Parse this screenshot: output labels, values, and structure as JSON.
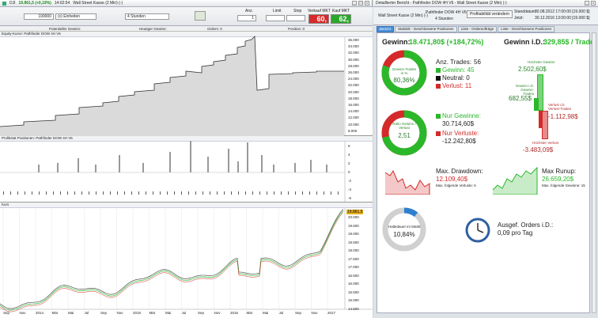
{
  "left_window": {
    "title_prefix": "DJI",
    "title_change": "19.861,5 (+0,19%)",
    "title_time": "14:02:54",
    "title_rest": "Wall Street Kasse (2 Min) (-)",
    "toolbar": {
      "qty_value": "100000",
      "unit_select": "(x) Einheiten",
      "period_select": "4 Stunden",
      "anz_label": "Anz.",
      "anz_value": "1",
      "limit_label": "Limit",
      "stop_label": "Stop",
      "sell_label": "Verkauf MKT",
      "sell_price": "60,",
      "buy_label": "Kauf MKT",
      "buy_price": "62,"
    },
    "header": {
      "potential": "Potentieller Gewinn:",
      "today": "Heutiger Gewinn:",
      "orders": "Orders: 0",
      "position": "Position: 0"
    },
    "equity": {
      "title": "Equity-Kurve: Pathfinder DOW 4H V6",
      "ticks": [
        "36.000",
        "34.000",
        "32.000",
        "30.000",
        "28.000",
        "26.000",
        "24.000",
        "22.000",
        "20.000",
        "18.000",
        "16.000",
        "14.000",
        "12.000",
        "10.000",
        "8.000"
      ],
      "last": "26.000"
    },
    "positions": {
      "title": "Prolikstat Positionen: Pathfinder DOW 4H V6",
      "ticks": [
        "6",
        "4",
        "2",
        "0",
        "-2",
        "-4",
        "-6"
      ]
    },
    "price": {
      "title": "Kurs",
      "last_label": "19.861,5",
      "ticks": [
        "20.000",
        "19.500",
        "19.000",
        "18.500",
        "18.000",
        "17.500",
        "17.000",
        "16.500",
        "16.000",
        "15.500",
        "15.000",
        "14.500"
      ]
    },
    "xaxis": [
      "Sep",
      "Nov",
      "2014",
      "Mär",
      "Mai",
      "Jul",
      "Sep",
      "Nov",
      "2015",
      "Mär",
      "Mai",
      "Jul",
      "Sep",
      "Nov",
      "2016",
      "Mär",
      "Mai",
      "Jul",
      "Sep",
      "Nov",
      "2017"
    ]
  },
  "right_window": {
    "title": "Detaillierter Bericht - Pathfinder DOW 4H V6 - Wall Street Kasse (2 Min) (-)",
    "header": {
      "instrument": "Wall Street Kasse (2 Min) (-)",
      "strategy": "Pathfinder DOW 4H V6",
      "period": "4 Stunden",
      "button": "Profitabilität verändern",
      "start_label": "Standdatum:",
      "start_value": "30.08.2012 17:00:00 [19.000 $]",
      "end_label": "Jetzt:",
      "end_value": "30.12.2016 13:00:00 [19.000 $]"
    },
    "tabs": [
      "Bericht",
      "Statistik - Geschlossene Positionen",
      "Liste - Ordereufträge",
      "Liste - Geschlossene Positionen"
    ],
    "gain": {
      "label": "Gewinn:",
      "value": "18.471,80$ (+184,72%)"
    },
    "gain_id": {
      "label": "Gewinn i.D.:",
      "value": "329,85$ / Trade"
    },
    "donut1": {
      "label": "Gewinn-Trades in %",
      "value": "80,36%",
      "pct": 80.36
    },
    "trades": {
      "label": "Anz. Trades:",
      "count": "56",
      "win_label": "Gewinn:",
      "win": "45",
      "neutral_label": "Neutral:",
      "neutral": "0",
      "loss_label": "Verlust:",
      "loss": "11"
    },
    "donut2": {
      "label": "Ratio Gewinn / Verlust",
      "value": "2,51",
      "pct": 71.5
    },
    "pnl": {
      "win_label": "Nur Gewinne:",
      "win": "30.714,60$",
      "loss_label": "Nur Verluste:",
      "loss": "-12.242,80$"
    },
    "bars": {
      "max_gain_label": "Höchster Gewinn",
      "max_gain": "2.502,60$",
      "avg_gain_label": "Gewinn i.D. Gewinn-Trades",
      "avg_gain": "682,55$",
      "avg_loss_label": "Verlust i.D. Verlust-Trades",
      "avg_loss": "-1.112,98$",
      "max_loss_label": "Höchster Verlust",
      "max_loss": "-3.483,09$"
    },
    "drawdown": {
      "label": "Max. Drawdown:",
      "value": "12.109,40$",
      "sub": "Max. folgende Verluste: 5"
    },
    "runup": {
      "label": "Max Runup:",
      "value": "26.659,20$",
      "sub": "Max. folgende Gewinne: 15"
    },
    "market": {
      "label": "Haltedauer im Markt",
      "value": "10,84%",
      "pct": 10.84
    },
    "orders": {
      "label": "Ausgef. Orders i.D.:",
      "value": "0,09 pro Tag"
    }
  },
  "colors": {
    "green": "#2ab82a",
    "red": "#d42a2a",
    "blue": "#2f7fd0"
  }
}
